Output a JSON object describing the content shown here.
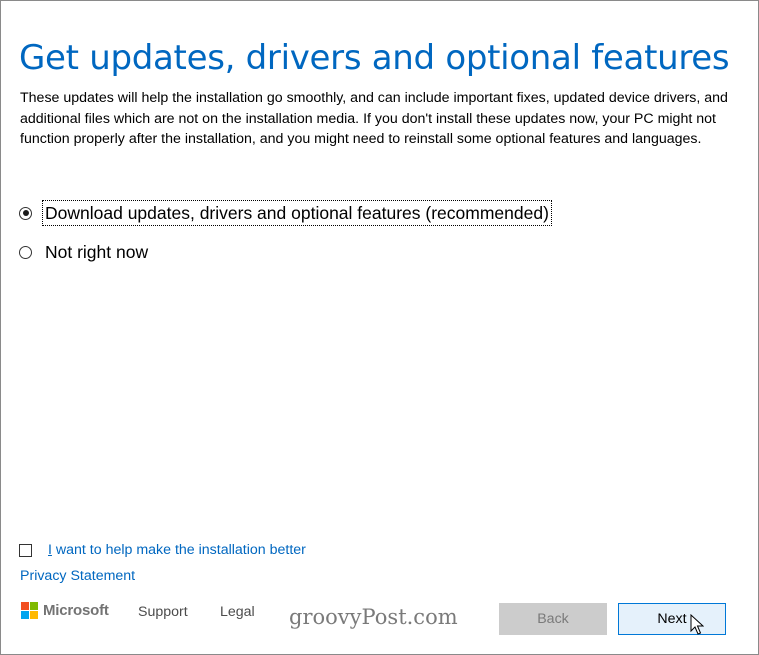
{
  "page": {
    "title": "Get updates, drivers and optional features",
    "description": "These updates will help the installation go smoothly, and can include important fixes, updated device drivers, and additional files which are not on the installation media. If you don't install these updates now, your PC might not function properly after the installation, and you might need to reinstall some optional features and languages."
  },
  "options": [
    {
      "label": "Download updates, drivers and optional features (recommended)",
      "selected": true
    },
    {
      "label": "Not right now",
      "selected": false
    }
  ],
  "help_checkbox": {
    "underlined_char": "I",
    "label_rest": " want to help make the installation better",
    "checked": false
  },
  "privacy_link": "Privacy Statement",
  "footer": {
    "brand": "Microsoft",
    "support": "Support",
    "legal": "Legal",
    "watermark": "groovyPost.com"
  },
  "buttons": {
    "back": "Back",
    "next": "Next"
  },
  "colors": {
    "accent": "#0067c0",
    "ms_red": "#f25022",
    "ms_green": "#7fba00",
    "ms_blue": "#00a4ef",
    "ms_yellow": "#ffb900"
  },
  "icons": {
    "cursor": "arrow-cursor-icon",
    "logo": "microsoft-logo-icon"
  }
}
